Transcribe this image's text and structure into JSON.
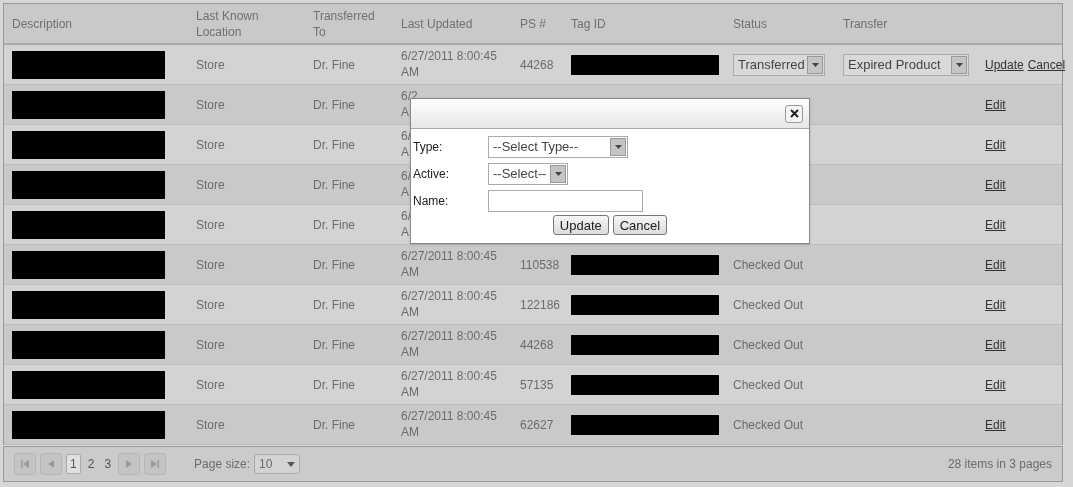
{
  "table": {
    "columns": [
      [
        "Description"
      ],
      [
        "Last Known",
        "Location"
      ],
      [
        "Transferred",
        "To"
      ],
      [
        "Last Updated"
      ],
      [
        "PS #"
      ],
      [
        "Tag ID"
      ],
      [
        "Status"
      ],
      [
        "Transfer"
      ]
    ],
    "rows": [
      {
        "kind": "edit",
        "description_redacted": true,
        "location": "Store",
        "transferred_to": "Dr. Fine",
        "last_updated": [
          "6/27/2011 8:00:45",
          "AM"
        ],
        "ps": "44268",
        "tag_redacted": true,
        "status_select": "Transferred",
        "transfer_select": "Expired Product",
        "actions": [
          "Update",
          "Cancel"
        ]
      },
      {
        "kind": "view",
        "description_redacted": true,
        "location": "Store",
        "transferred_to": "Dr. Fine",
        "last_updated": [
          "6/2",
          "A"
        ],
        "tag_redacted": false,
        "actions": [
          "Edit"
        ]
      },
      {
        "kind": "view",
        "description_redacted": true,
        "location": "Store",
        "transferred_to": "Dr. Fine",
        "last_updated": [
          "6/",
          "A"
        ],
        "tag_redacted": false,
        "actions": [
          "Edit"
        ]
      },
      {
        "kind": "view",
        "description_redacted": true,
        "location": "Store",
        "transferred_to": "Dr. Fine",
        "last_updated": [
          "6/",
          "A"
        ],
        "tag_redacted": false,
        "actions": [
          "Edit"
        ]
      },
      {
        "kind": "view",
        "description_redacted": true,
        "location": "Store",
        "transferred_to": "Dr. Fine",
        "last_updated": [
          "6/",
          "A"
        ],
        "tag_redacted": false,
        "actions": [
          "Edit"
        ]
      },
      {
        "kind": "view",
        "description_redacted": true,
        "location": "Store",
        "transferred_to": "Dr. Fine",
        "last_updated": [
          "6/27/2011 8:00:45",
          "AM"
        ],
        "ps": "110538",
        "tag_redacted": true,
        "status": "Checked Out",
        "actions": [
          "Edit"
        ]
      },
      {
        "kind": "view",
        "description_redacted": true,
        "location": "Store",
        "transferred_to": "Dr. Fine",
        "last_updated": [
          "6/27/2011 8:00:45",
          "AM"
        ],
        "ps": "122186",
        "tag_redacted": true,
        "status": "Checked Out",
        "actions": [
          "Edit"
        ]
      },
      {
        "kind": "view",
        "description_redacted": true,
        "location": "Store",
        "transferred_to": "Dr. Fine",
        "last_updated": [
          "6/27/2011 8:00:45",
          "AM"
        ],
        "ps": "44268",
        "tag_redacted": true,
        "status": "Checked Out",
        "actions": [
          "Edit"
        ]
      },
      {
        "kind": "view",
        "description_redacted": true,
        "location": "Store",
        "transferred_to": "Dr. Fine",
        "last_updated": [
          "6/27/2011 8:00:45",
          "AM"
        ],
        "ps": "57135",
        "tag_redacted": true,
        "status": "Checked Out",
        "actions": [
          "Edit"
        ]
      },
      {
        "kind": "view",
        "description_redacted": true,
        "location": "Store",
        "transferred_to": "Dr. Fine",
        "last_updated": [
          "6/27/2011 8:00:45",
          "AM"
        ],
        "ps": "62627",
        "tag_redacted": true,
        "status": "Checked Out",
        "actions": [
          "Edit"
        ]
      }
    ]
  },
  "pager": {
    "pages": [
      {
        "label": "1",
        "selected": true
      },
      {
        "label": "2",
        "selected": false
      },
      {
        "label": "3",
        "selected": false
      }
    ],
    "page_size_label": "Page size:",
    "page_size": "10",
    "summary": "28 items in 3 pages"
  },
  "dialog": {
    "fields": [
      {
        "label": "Type:",
        "kind": "select",
        "value": "--Select Type--"
      },
      {
        "label": "Active:",
        "kind": "select",
        "value": "--Select--"
      },
      {
        "label": "Name:",
        "kind": "text"
      }
    ],
    "buttons": [
      "Update",
      "Cancel"
    ]
  }
}
